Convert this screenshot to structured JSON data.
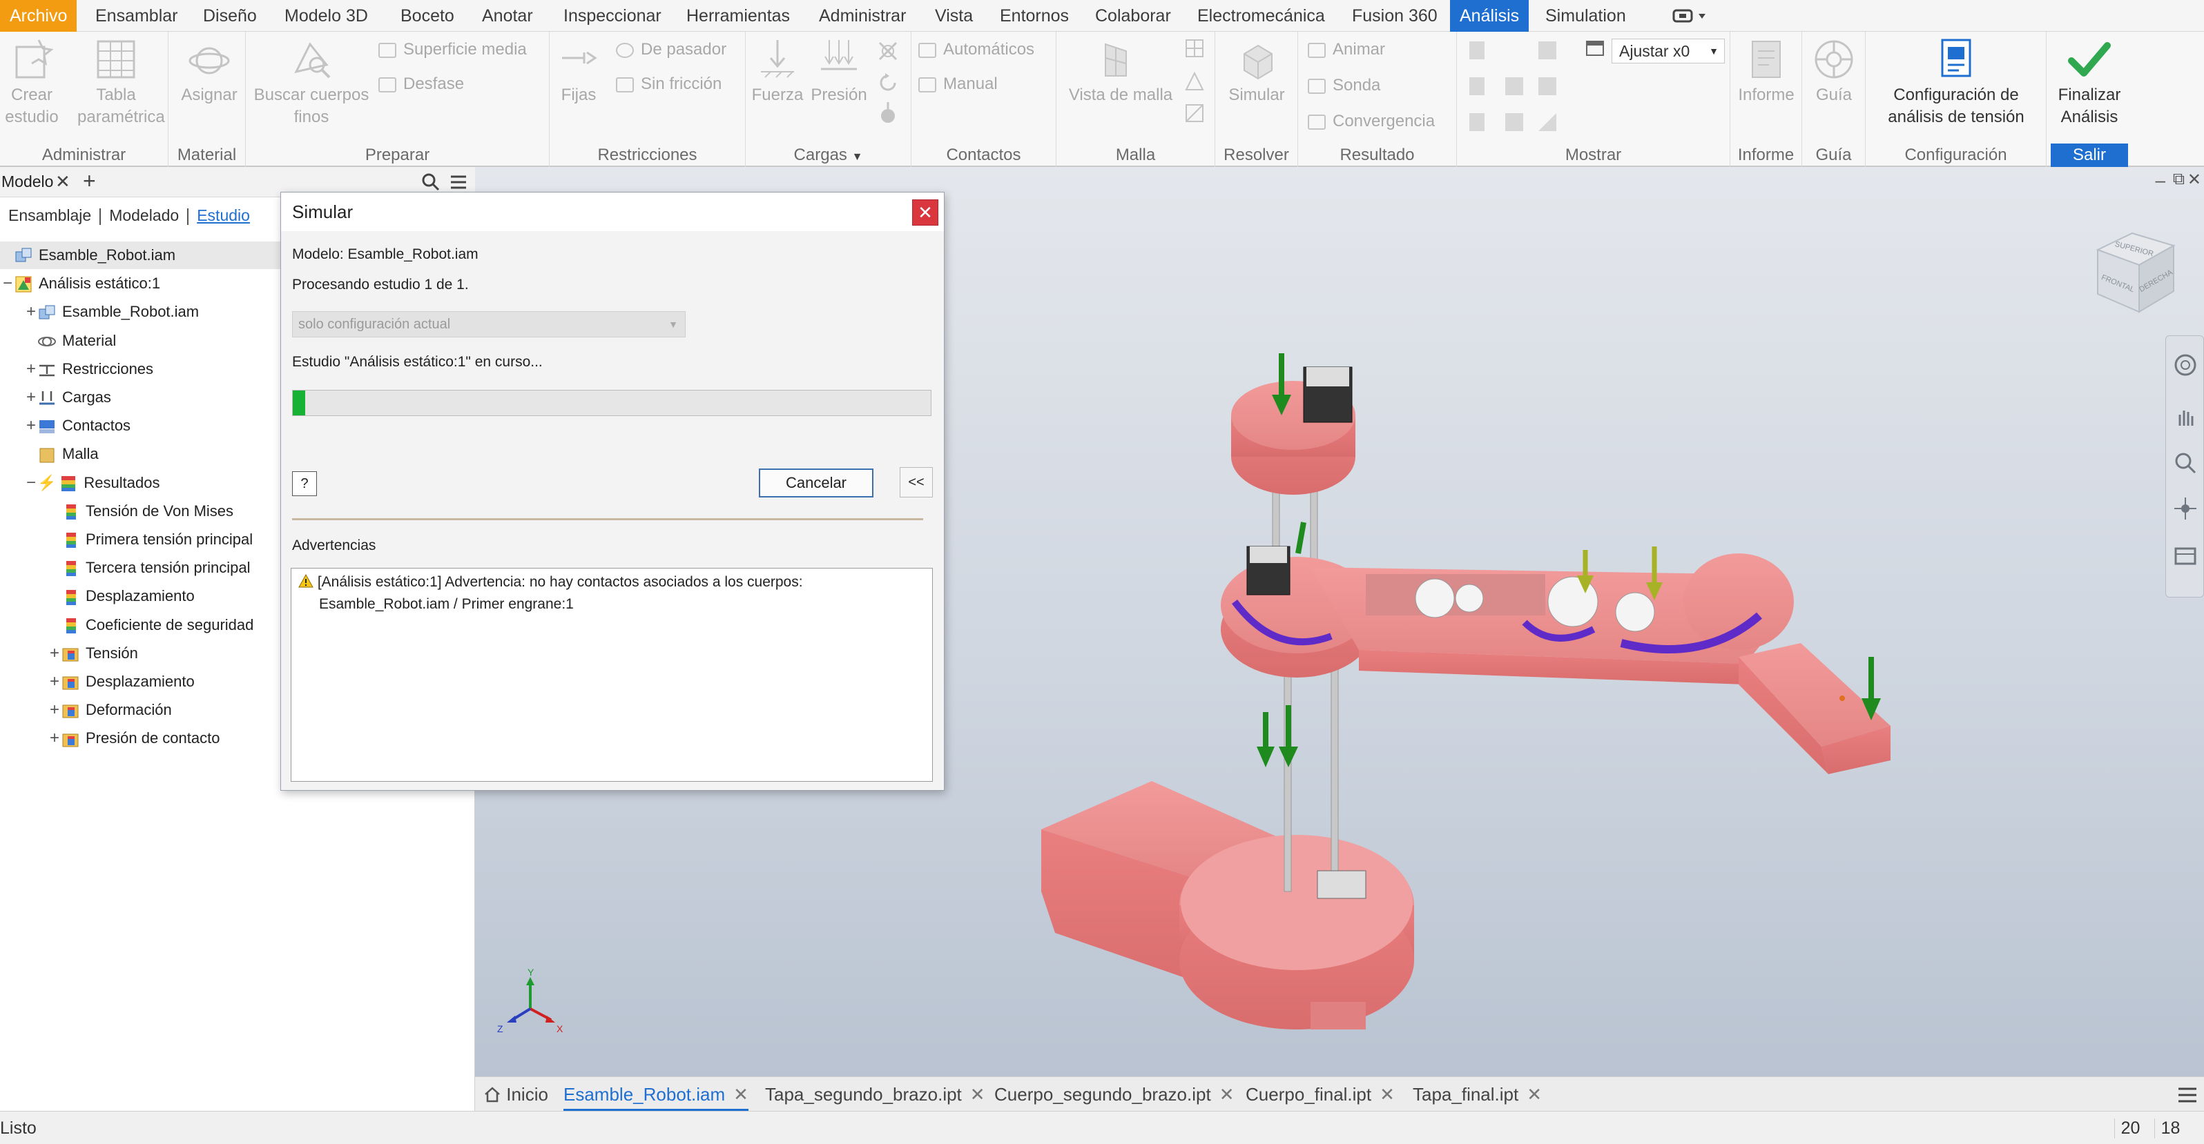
{
  "menu": {
    "tabs": [
      "Archivo",
      "Ensamblar",
      "Diseño",
      "Modelo 3D",
      "Boceto",
      "Anotar",
      "Inspeccionar",
      "Herramientas",
      "Administrar",
      "Vista",
      "Entornos",
      "Colaborar",
      "Electromecánica",
      "Fusion 360",
      "Análisis",
      "Simulation"
    ],
    "active": "Análisis"
  },
  "ribbon": {
    "administrar": {
      "label": "Administrar",
      "crear": "Crear estudio",
      "tabla": "Tabla paramétrica"
    },
    "material": {
      "label": "Material",
      "asignar": "Asignar"
    },
    "preparar": {
      "label": "Preparar",
      "buscar": "Buscar cuerpos finos",
      "superficie": "Superficie media",
      "desfase": "Desfase"
    },
    "restricciones": {
      "label": "Restricciones",
      "fijas": "Fijas",
      "pasador": "De pasador",
      "friccion": "Sin fricción"
    },
    "cargas": {
      "label": "Cargas",
      "fuerza": "Fuerza",
      "presion": "Presión"
    },
    "contactos": {
      "label": "Contactos",
      "automaticos": "Automáticos",
      "manual": "Manual"
    },
    "malla": {
      "label": "Malla",
      "vista": "Vista de malla"
    },
    "resolver": {
      "label": "Resolver",
      "simular": "Simular"
    },
    "resultado": {
      "label": "Resultado",
      "animar": "Animar",
      "sonda": "Sonda",
      "convergencia": "Convergencia"
    },
    "mostrar": {
      "label": "Mostrar",
      "ajustar": "Ajustar x0"
    },
    "informe": {
      "label": "Informe",
      "informe": "Informe"
    },
    "guia": {
      "label": "Guía",
      "guia": "Guía"
    },
    "configuracion": {
      "label": "Configuración",
      "config": "Configuración de análisis de tensión"
    },
    "salir": {
      "label": "Salir",
      "finalizar": "Finalizar Análisis"
    },
    "colors": {
      "accent": "#1f6fd0",
      "file": "#f39c12",
      "finish_check": "#2fa84f"
    }
  },
  "panel": {
    "title": "Modelo",
    "tabs": [
      "Ensamblaje",
      "Modelado",
      "Estudio"
    ],
    "active_tab": "Estudio",
    "tree": [
      {
        "label": "Esamble_Robot.iam",
        "exp": "",
        "icon": "assembly-icon",
        "indent": 0
      },
      {
        "label": "Análisis estático:1",
        "exp": "−",
        "icon": "analysis-icon",
        "indent": 0
      },
      {
        "label": "Esamble_Robot.iam",
        "exp": "+",
        "icon": "assembly-icon",
        "indent": 1
      },
      {
        "label": "Material",
        "exp": "",
        "icon": "material-icon",
        "indent": 1
      },
      {
        "label": "Restricciones",
        "exp": "+",
        "icon": "constraint-icon",
        "indent": 1
      },
      {
        "label": "Cargas",
        "exp": "+",
        "icon": "load-icon",
        "indent": 1
      },
      {
        "label": "Contactos",
        "exp": "+",
        "icon": "contact-icon",
        "indent": 1
      },
      {
        "label": "Malla",
        "exp": "",
        "icon": "mesh-icon",
        "indent": 1
      },
      {
        "label": "Resultados",
        "exp": "−",
        "icon": "results-icon",
        "indent": 1
      },
      {
        "label": "Tensión de Von Mises",
        "exp": "",
        "icon": "result-map-icon",
        "indent": 2
      },
      {
        "label": "Primera tensión principal",
        "exp": "",
        "icon": "result-map-icon",
        "indent": 2
      },
      {
        "label": "Tercera tensión principal",
        "exp": "",
        "icon": "result-map-icon",
        "indent": 2
      },
      {
        "label": "Desplazamiento",
        "exp": "",
        "icon": "result-map-icon",
        "indent": 2
      },
      {
        "label": "Coeficiente de seguridad",
        "exp": "",
        "icon": "result-map-icon",
        "indent": 2
      },
      {
        "label": "Tensión",
        "exp": "+",
        "icon": "result-folder-icon",
        "indent": 2
      },
      {
        "label": "Desplazamiento",
        "exp": "+",
        "icon": "result-folder-icon",
        "indent": 2
      },
      {
        "label": "Deformación",
        "exp": "+",
        "icon": "result-folder-icon",
        "indent": 2
      },
      {
        "label": "Presión de contacto",
        "exp": "+",
        "icon": "result-folder-icon",
        "indent": 2
      }
    ]
  },
  "dialog": {
    "title": "Simular",
    "model_line": "Modelo: Esamble_Robot.iam",
    "processing": "Procesando estudio 1 de 1.",
    "select_value": "solo configuración actual",
    "study_status": "Estudio \"Análisis estático:1\" en curso...",
    "progress": 0.02,
    "cancel": "Cancelar",
    "collapse": "<<",
    "help": "?",
    "warnings_title": "Advertencias",
    "warning_line1": "[Análisis estático:1] Advertencia: no hay contactos asociados a los cuerpos:",
    "warning_line2": "Esamble_Robot.iam / Primer engrane:1"
  },
  "doctabs": {
    "home": "Inicio",
    "tabs": [
      "Esamble_Robot.iam",
      "Tapa_segundo_brazo.ipt",
      "Cuerpo_segundo_brazo.ipt",
      "Cuerpo_final.ipt",
      "Tapa_final.ipt"
    ],
    "active": "Esamble_Robot.iam"
  },
  "status": {
    "text": "Listo",
    "num1": "20",
    "num2": "18"
  },
  "viewcube": {
    "front": "FRONTAL",
    "right": "DERECHA",
    "top": "SUPERIOR"
  },
  "triad": {
    "x": "X",
    "y": "Y",
    "z": "Z"
  }
}
